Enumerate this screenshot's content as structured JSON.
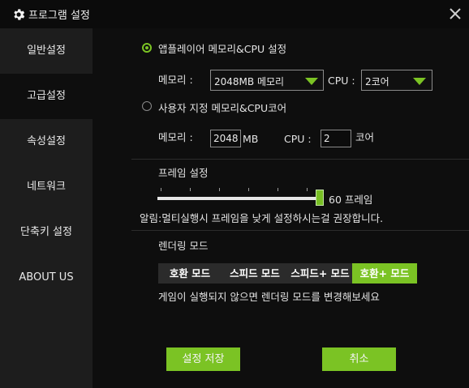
{
  "window": {
    "title": "프로그램 설정",
    "gear_icon": "gear-icon",
    "close_icon": "close-icon"
  },
  "colors": {
    "accent": "#7bc324",
    "background": "#0e0e0e",
    "sidebar": "#1d1d1d"
  },
  "sidebar": {
    "items": [
      {
        "label": "일반설정",
        "active": false
      },
      {
        "label": "고급설정",
        "active": true
      },
      {
        "label": "속성설정",
        "active": false
      },
      {
        "label": "네트워크",
        "active": false
      },
      {
        "label": "단축키 설정",
        "active": false
      },
      {
        "label": "ABOUT US",
        "active": false
      }
    ]
  },
  "memory_cpu": {
    "app_recommended": {
      "label": "앱플레이어 메모리&CPU 설정",
      "selected": true,
      "memory_label": "메모리 :",
      "memory_value": "2048MB 메모리",
      "cpu_label": "CPU :",
      "cpu_value": "2코어"
    },
    "custom": {
      "label": "사용자 지정 메모리&CPU코어",
      "selected": false,
      "memory_label": "메모리 :",
      "memory_value": "2048",
      "memory_unit": "MB",
      "cpu_label": "CPU :",
      "cpu_value": "2",
      "cpu_unit": "코어"
    }
  },
  "frame": {
    "title": "프레임 설정",
    "value_label": "60 프레임",
    "value": 60,
    "notice": "알림:멀티실행시 프레임을 낮게 설정하시는걸 권장합니다."
  },
  "render": {
    "title": "렌더링 모드",
    "modes": [
      {
        "label": "호환 모드",
        "active": false
      },
      {
        "label": "스피드 모드",
        "active": false
      },
      {
        "label": "스피드+ 모드",
        "active": false
      },
      {
        "label": "호환+ 모드",
        "active": true
      }
    ],
    "hint": "게임이 실행되지 않으면 렌더링 모드를 변경해보세요"
  },
  "buttons": {
    "save": "설정 저장",
    "cancel": "취소"
  }
}
